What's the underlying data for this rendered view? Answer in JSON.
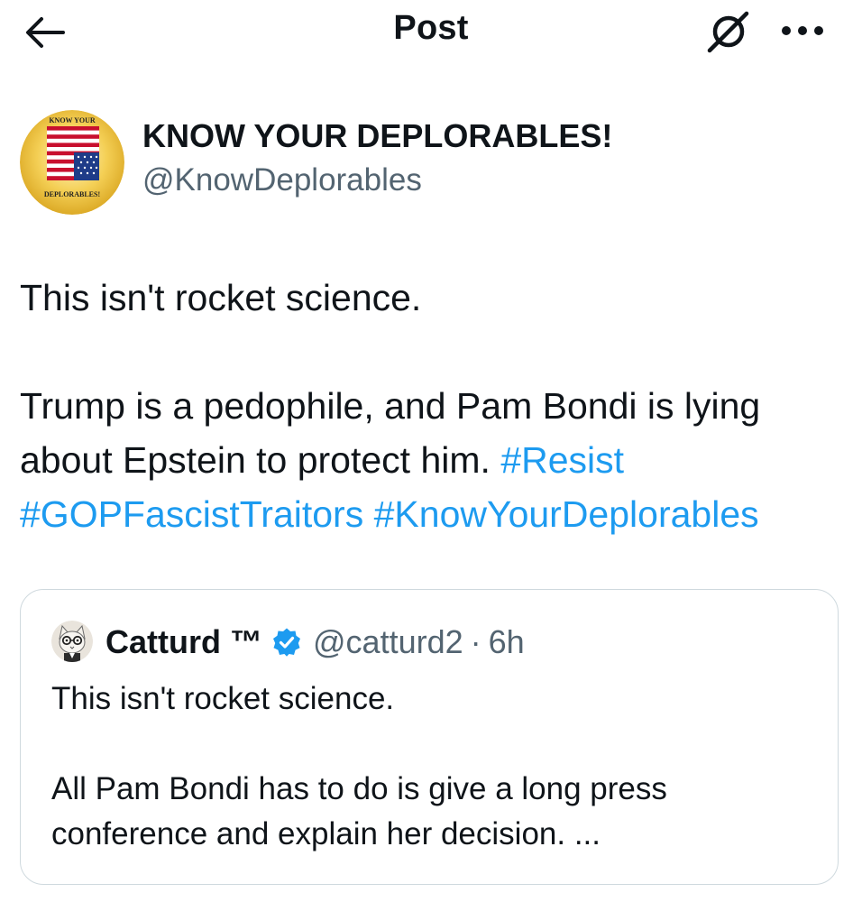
{
  "header": {
    "title": "Post",
    "back_icon": "arrow-left-icon",
    "grok_icon": "grok-icon",
    "more_icon": "more-horizontal-icon"
  },
  "author": {
    "name": "KNOW YOUR DEPLORABLES!",
    "handle": "@KnowDeplorables",
    "avatar_top_text": "KNOW YOUR",
    "avatar_bottom_text": "DEPLORABLES!"
  },
  "post": {
    "line1": "This isn't rocket science.",
    "line2": "Trump is a pedophile, and Pam Bondi is lying",
    "line3": "about Epstein to protect him.",
    "hashtag1": "#Resist",
    "hashtag2": "#GOPFascistTraitors",
    "hashtag3": "#KnowYourDeplorables"
  },
  "quote": {
    "name": "Catturd ™",
    "handle": "@catturd2",
    "separator": "·",
    "time": "6h",
    "line1": "This isn't rocket science.",
    "line2": "All Pam Bondi has to do is give a long press",
    "line3": "conference and explain her decision.  ..."
  },
  "colors": {
    "text": "#0f1419",
    "secondary": "#536471",
    "link": "#1d9bf0",
    "border": "#cfd9de"
  }
}
